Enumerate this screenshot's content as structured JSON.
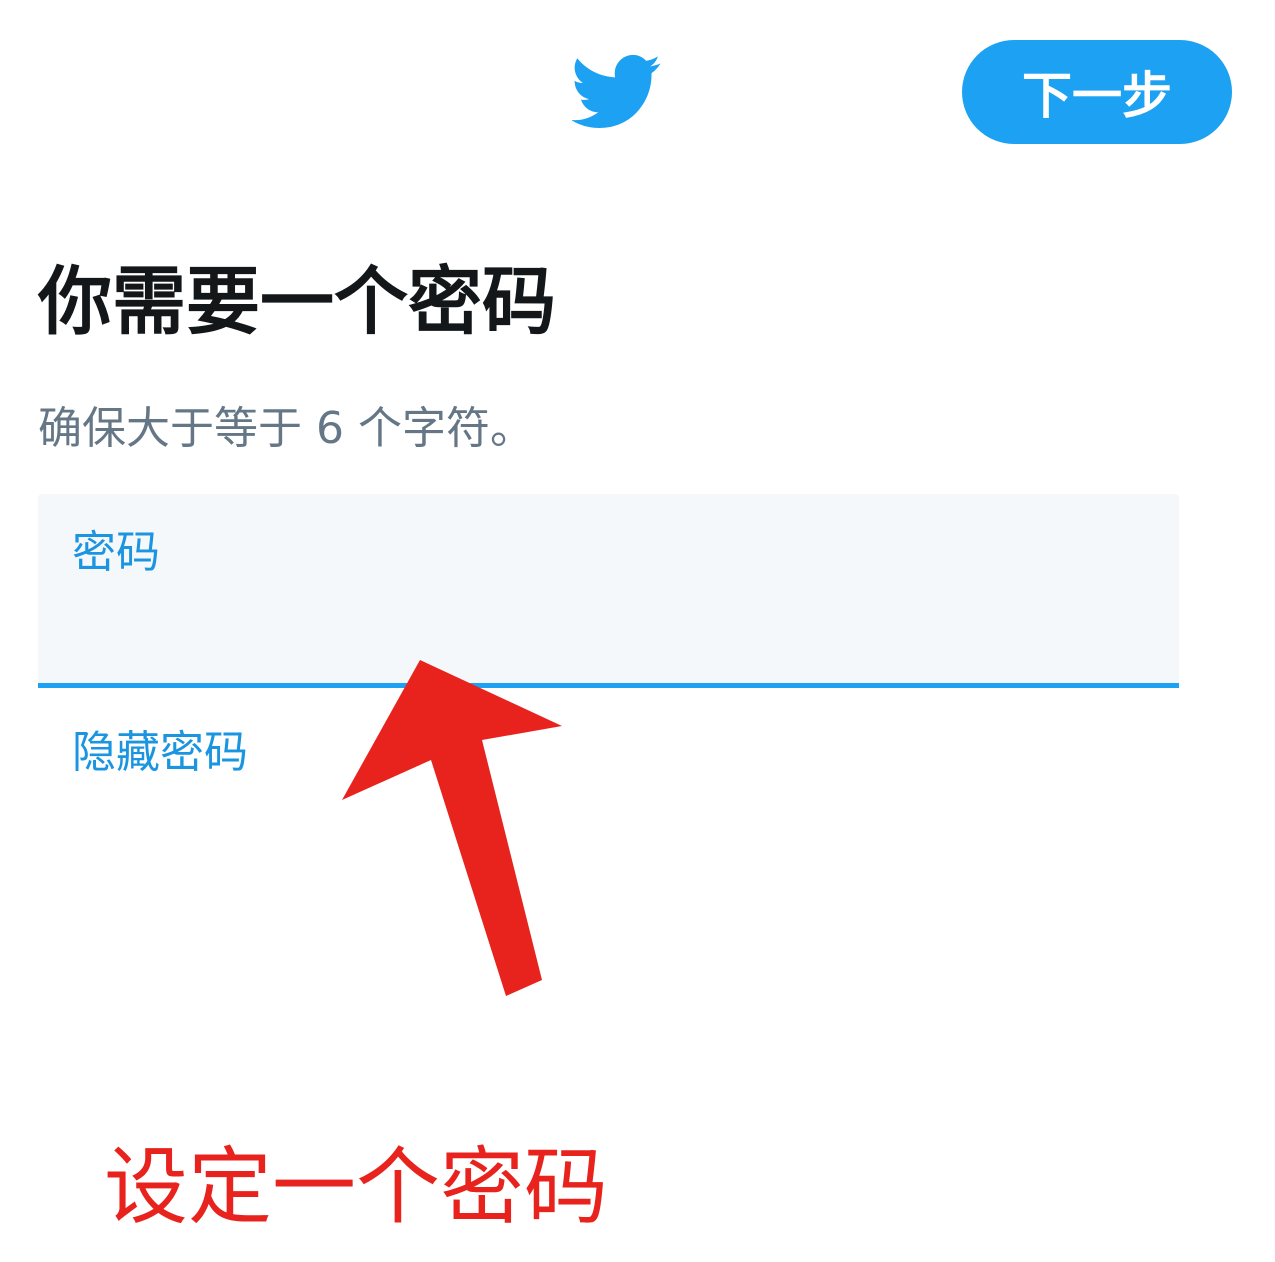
{
  "header": {
    "logo_icon": "twitter-bird-icon",
    "brand_color": "#1da1f2",
    "next_button_label": "下一步"
  },
  "main": {
    "title": "你需要一个密码",
    "subtitle": "确保大于等于 6 个字符。",
    "password_field": {
      "label": "密码",
      "value": ""
    },
    "hide_password_label": "隐藏密码"
  },
  "annotation": {
    "arrow_icon": "red-arrow-up-icon",
    "color": "#e8231d",
    "text": "设定一个密码"
  }
}
